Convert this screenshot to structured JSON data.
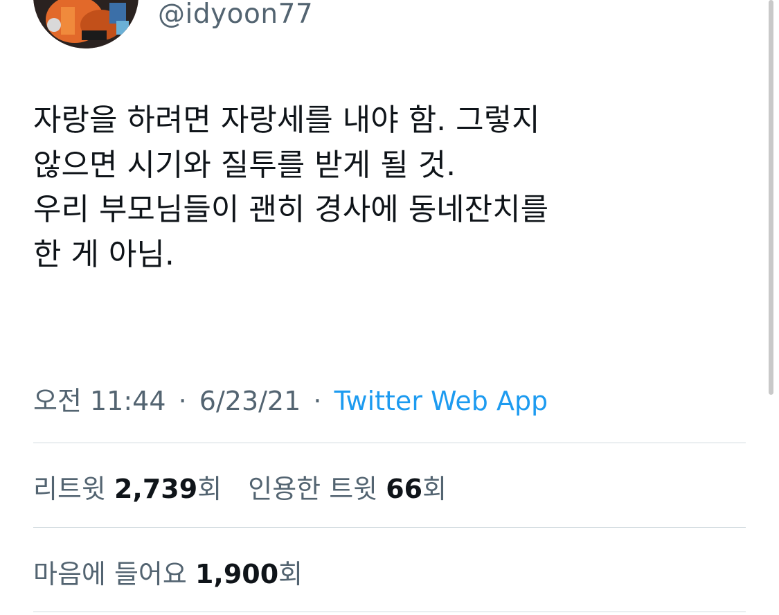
{
  "author": {
    "handle": "@idyoon77"
  },
  "tweet": {
    "lines": [
      "자랑을 하려면 자랑세를 내야 함. 그렇지",
      "않으면 시기와 질투를 받게 될 것.",
      "우리 부모님들이 괜히 경사에 동네잔치를",
      "한 게 아님."
    ],
    "time": "오전 11:44",
    "date": "6/23/21",
    "separator": "·",
    "source": "Twitter Web App"
  },
  "stats": {
    "retweets_label": "리트윗",
    "retweets_count": "2,739",
    "retweets_unit": "회",
    "quotes_label": "인용한 트윗",
    "quotes_count": "66",
    "quotes_unit": "회",
    "likes_label": "마음에 들어요",
    "likes_count": "1,900",
    "likes_unit": "회"
  },
  "colors": {
    "text": "#0f1419",
    "secondary": "#536471",
    "link": "#1d9bf0",
    "divider": "#cfd9de"
  }
}
